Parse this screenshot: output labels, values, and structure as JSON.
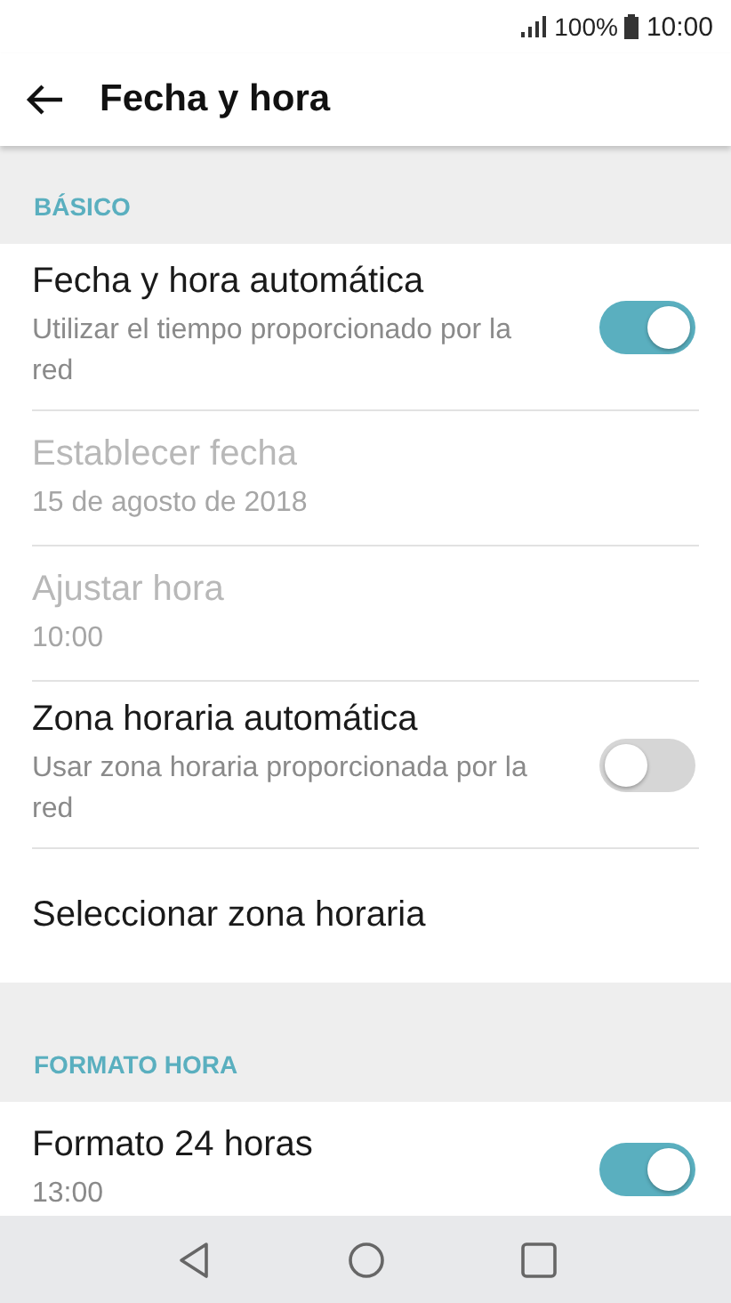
{
  "status_bar": {
    "battery": "100%",
    "time": "10:00"
  },
  "app_bar": {
    "title": "Fecha y hora"
  },
  "sections": [
    {
      "title": "BÁSICO",
      "items": [
        {
          "kind": "toggle",
          "title": "Fecha y hora automática",
          "subtitle": "Utilizar el tiempo proporcionado por la red",
          "on": true,
          "disabled": false
        },
        {
          "kind": "plain",
          "title": "Establecer fecha",
          "subtitle": "15 de agosto de 2018",
          "disabled": true
        },
        {
          "kind": "plain",
          "title": "Ajustar hora",
          "subtitle": "10:00",
          "disabled": true
        },
        {
          "kind": "toggle",
          "title": "Zona horaria automática",
          "subtitle": "Usar zona horaria proporcionada por la red",
          "on": false,
          "disabled": false
        },
        {
          "kind": "plain",
          "title": "Seleccionar zona horaria",
          "disabled": false
        }
      ]
    },
    {
      "title": "FORMATO HORA",
      "items": [
        {
          "kind": "toggle",
          "title": "Formato 24 horas",
          "subtitle": "13:00",
          "on": true,
          "disabled": false
        }
      ]
    }
  ]
}
